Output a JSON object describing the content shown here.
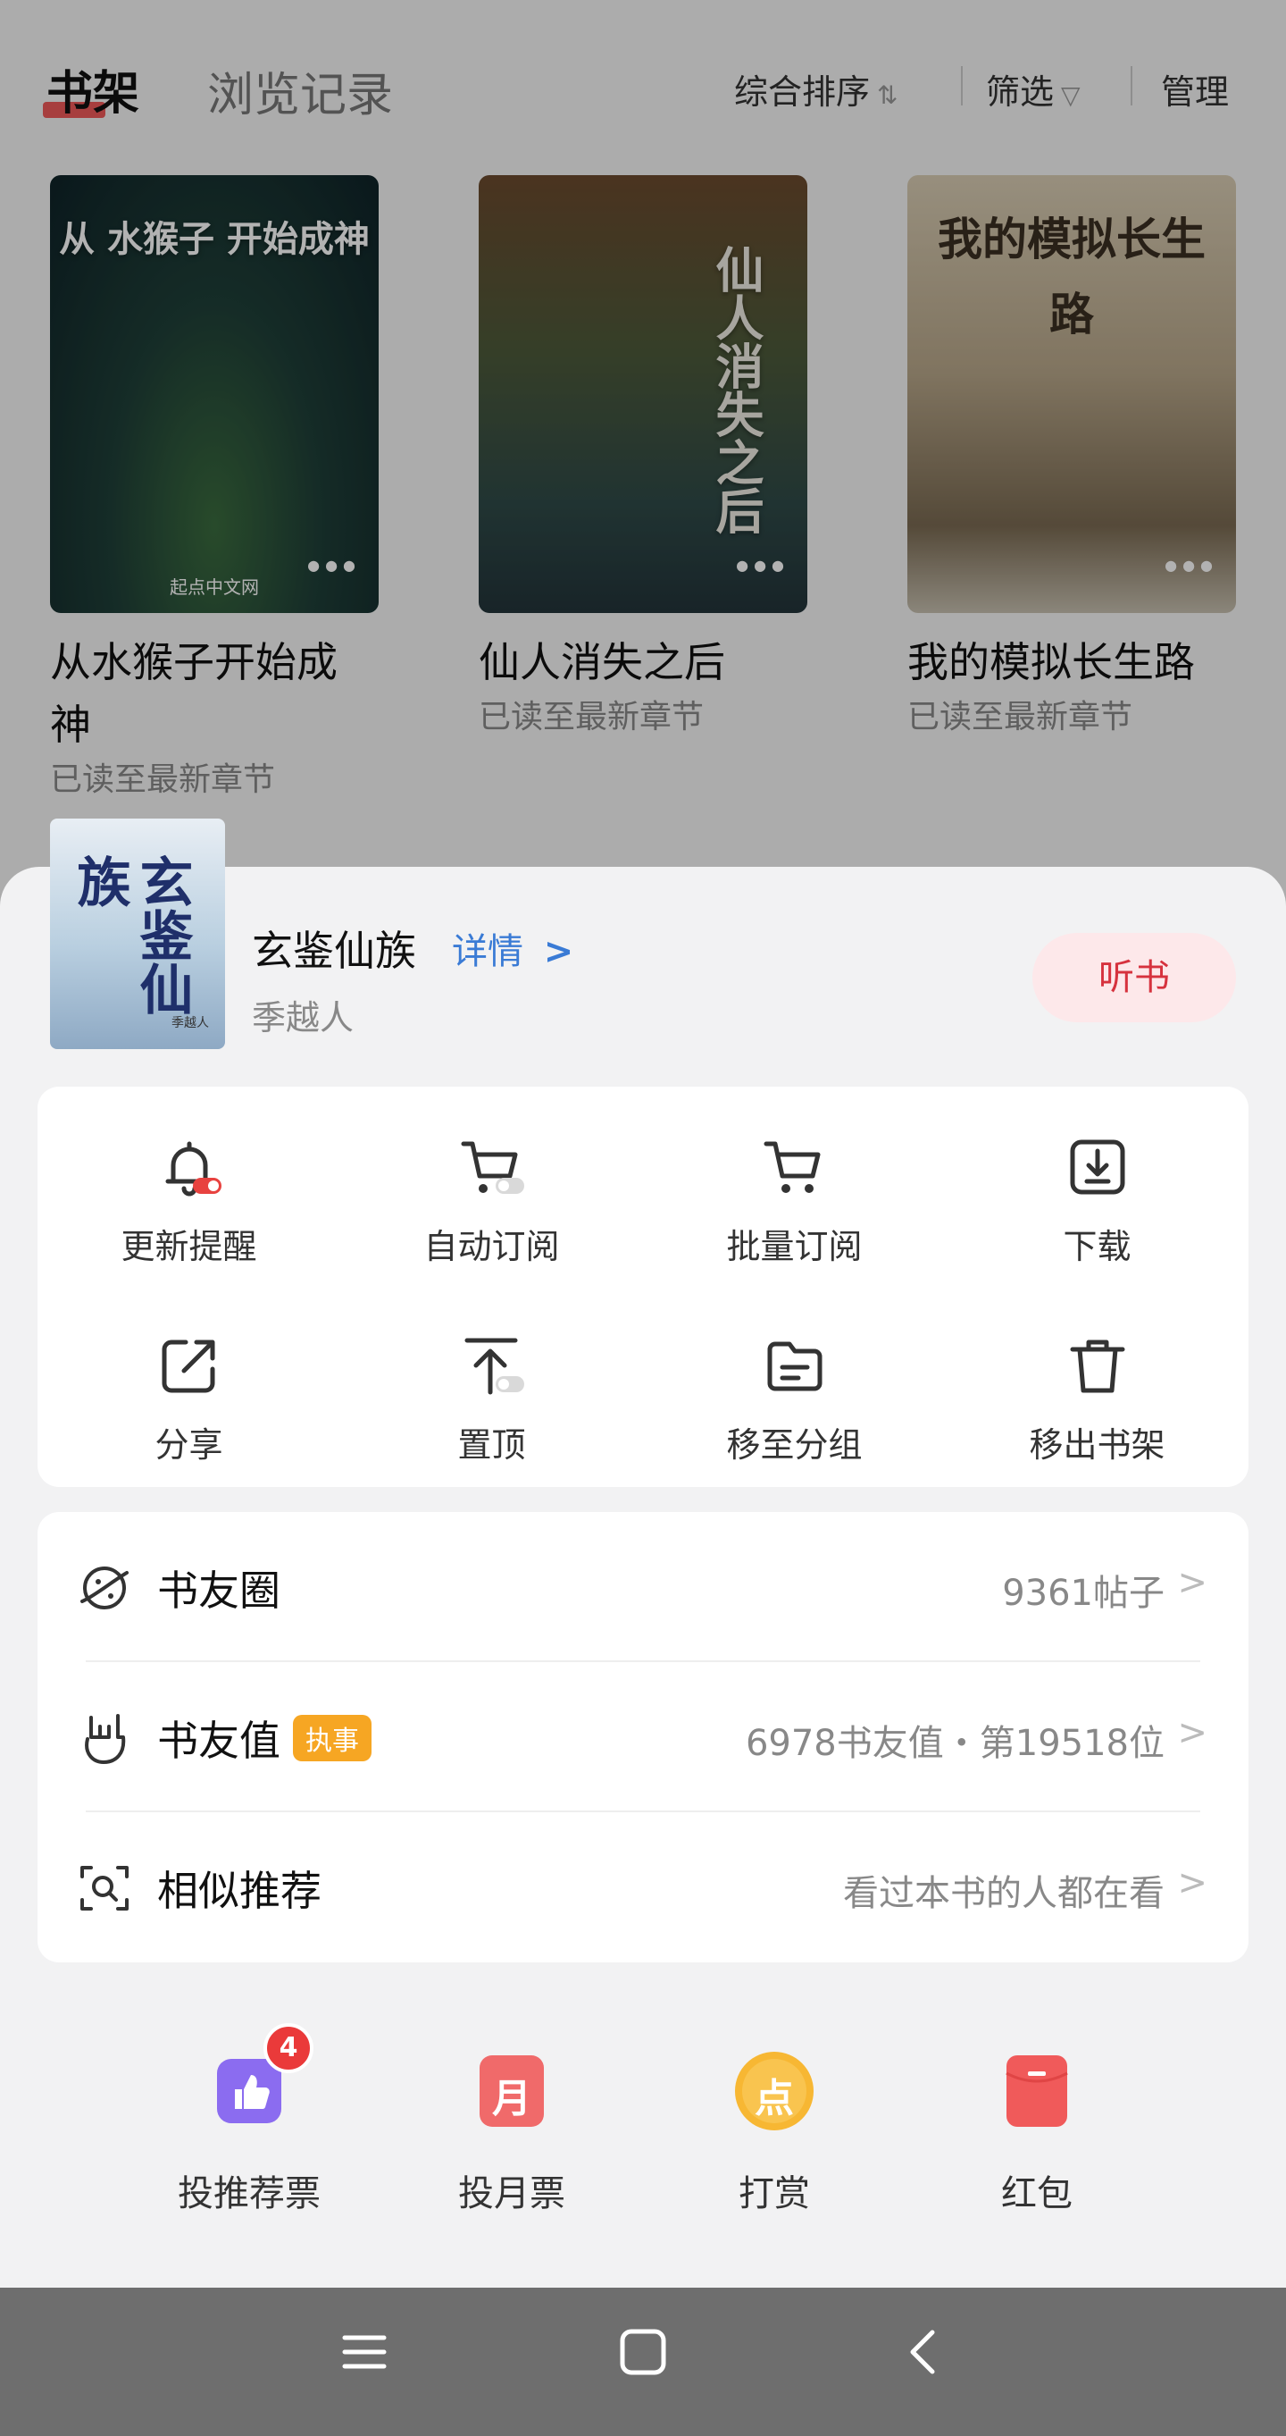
{
  "topbar": {
    "tab_bookshelf": "书架",
    "tab_history": "浏览记录",
    "sort_label": "综合排序",
    "filter_label": "筛选",
    "manage_label": "管理"
  },
  "shelf_books": [
    {
      "cover_text": "从 水猴子 开始成神",
      "title_line1": "从水猴子开始成",
      "title_line2": "神",
      "status": "已读至最新章节",
      "cover_brand": "起点中文网"
    },
    {
      "cover_text": "仙人消失之后",
      "title_line1": "仙人消失之后",
      "status": "已读至最新章节"
    },
    {
      "cover_text": "我的模拟长生路",
      "title_line1": "我的模拟长生路",
      "status": "已读至最新章节"
    }
  ],
  "sheet": {
    "book_title": "玄鉴仙族",
    "detail_label": "详情",
    "detail_chevron": ">",
    "author": "季越人",
    "cover_text": "玄鉴仙族",
    "cover_author": "季越人",
    "listen_label": "听书"
  },
  "actions": [
    {
      "label": "更新提醒",
      "icon": "bell-icon"
    },
    {
      "label": "自动订阅",
      "icon": "cart-toggle-icon"
    },
    {
      "label": "批量订阅",
      "icon": "cart-icon"
    },
    {
      "label": "下载",
      "icon": "download-icon"
    },
    {
      "label": "分享",
      "icon": "share-icon"
    },
    {
      "label": "置顶",
      "icon": "pin-top-icon"
    },
    {
      "label": "移至分组",
      "icon": "folder-icon"
    },
    {
      "label": "移出书架",
      "icon": "trash-icon"
    }
  ],
  "links": {
    "circle": {
      "label": "书友圈",
      "value": "9361帖子"
    },
    "fan_value": {
      "label": "书友值",
      "badge": "执事",
      "value": "6978书友值・第19518位"
    },
    "similar": {
      "label": "相似推荐",
      "value": "看过本书的人都在看"
    },
    "chevron": ">"
  },
  "gifts": [
    {
      "label": "投推荐票",
      "icon": "thumbs-up-ticket-icon",
      "badge": "4",
      "color": "#8b6cf0"
    },
    {
      "label": "投月票",
      "icon": "month-ticket-icon",
      "glyph": "月",
      "color": "#f06a6a"
    },
    {
      "label": "打赏",
      "icon": "reward-coin-icon",
      "glyph": "点",
      "color": "#f7b733"
    },
    {
      "label": "红包",
      "icon": "red-packet-icon",
      "color": "#f05a5a"
    }
  ],
  "colors": {
    "accent_red": "#d6323e",
    "link_blue": "#3a7bd5",
    "badge_orange": "#f6a623"
  }
}
